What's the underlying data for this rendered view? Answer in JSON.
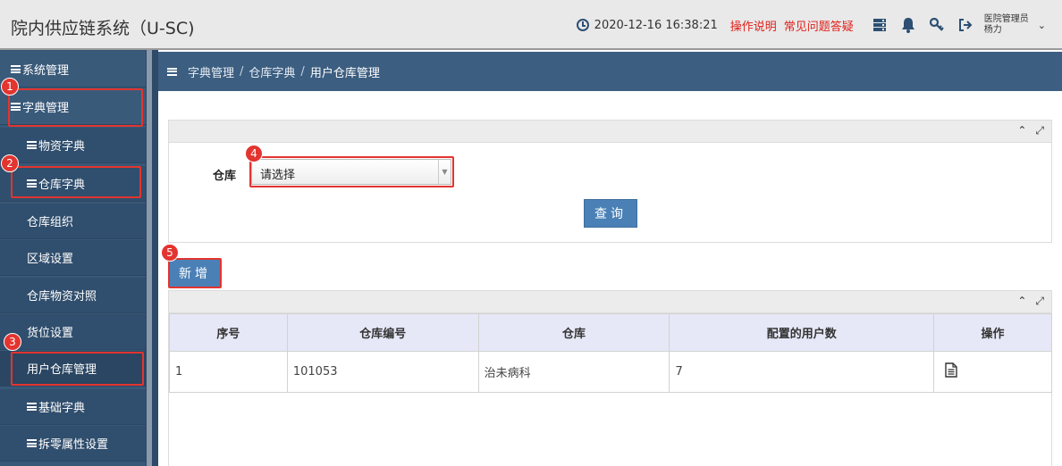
{
  "header": {
    "app_title": "院内供应链系统（U-SC)",
    "datetime": "2020-12-16 16:38:21",
    "links": [
      "操作说明",
      "常见问题答疑"
    ],
    "user_role": "医院管理员",
    "user_name": "杨力"
  },
  "sidebar": {
    "items": [
      {
        "label": "系统管理",
        "level": "top"
      },
      {
        "label": "字典管理",
        "level": "top"
      },
      {
        "label": "物资字典",
        "level": "sub"
      },
      {
        "label": "仓库字典",
        "level": "sub"
      },
      {
        "label": "仓库组织",
        "level": "sub"
      },
      {
        "label": "区域设置",
        "level": "sub"
      },
      {
        "label": "仓库物资对照",
        "level": "sub"
      },
      {
        "label": "货位设置",
        "level": "sub"
      },
      {
        "label": "用户仓库管理",
        "level": "sub"
      },
      {
        "label": "基础字典",
        "level": "sub"
      },
      {
        "label": "拆零属性设置",
        "level": "sub"
      }
    ]
  },
  "breadcrumb": [
    "字典管理",
    "仓库字典",
    "用户仓库管理"
  ],
  "search": {
    "warehouse_label": "仓库",
    "warehouse_select_value": "请选择",
    "query_label": "查询"
  },
  "actions": {
    "add_label": "新增"
  },
  "table": {
    "headers": [
      "序号",
      "仓库编号",
      "仓库",
      "配置的用户数",
      "操作"
    ],
    "rows": [
      {
        "index": "1",
        "code": "101053",
        "name": "治未病科",
        "user_count": "7"
      }
    ]
  },
  "annotations": [
    "1",
    "2",
    "3",
    "4",
    "5"
  ],
  "colors": {
    "highlight": "#e3342f",
    "button": "#4a80b6",
    "sidebar": "#385878",
    "header_bar": "#3c5e80"
  }
}
